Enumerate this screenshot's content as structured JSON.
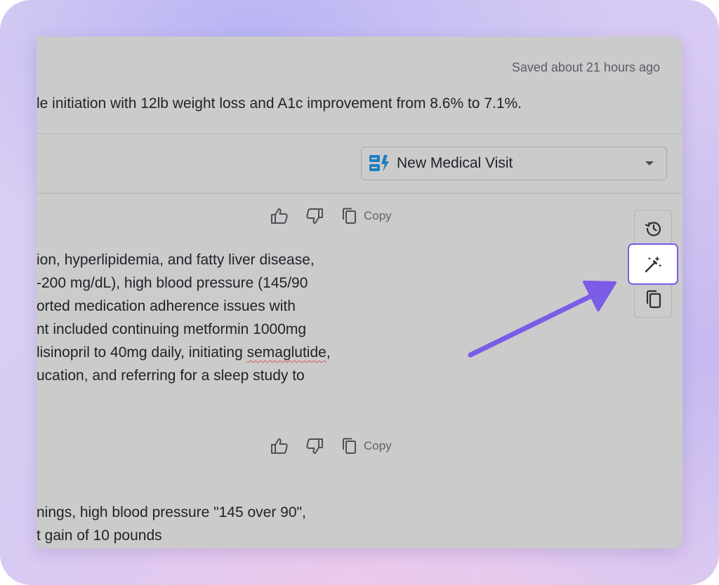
{
  "header": {
    "saved_status": "Saved about 21 hours ago",
    "summary_text": "le initiation with 12lb weight loss and A1c improvement from 8.6% to 7.1%."
  },
  "template_select": {
    "selected": "New Medical Visit",
    "icon": "template-icon",
    "icon_color": "#1f7fbf"
  },
  "feedback_bar": {
    "copy_label": "Copy",
    "copy_label_2": "Copy"
  },
  "note_lines": [
    "ion, hyperlipidemia, and fatty liver disease,",
    "-200 mg/dL), high blood pressure (145/90",
    "orted medication adherence issues with",
    "nt included continuing metformin 1000mg",
    " lisinopril to 40mg daily, initiating ",
    "semaglutide",
    ",",
    "ucation, and referring for a sleep study to"
  ],
  "transcript_lines": [
    "nings, high blood pressure \"145 over 90\",",
    "t gain of 10 pounds"
  ],
  "side_actions": {
    "history": "history-icon",
    "magic": "magic-wand-icon",
    "copy": "copy-icon"
  },
  "colors": {
    "highlight": "#7b5ce6",
    "arrow": "#7b5ce6"
  }
}
